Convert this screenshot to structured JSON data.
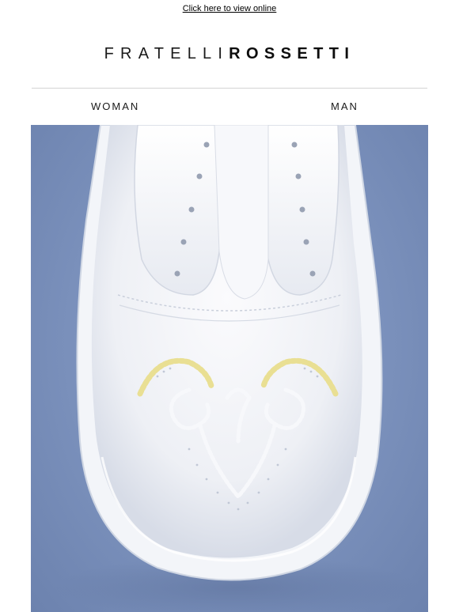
{
  "preheader": {
    "view_online_label": "Click here to view online"
  },
  "brand": {
    "name_light": "FRATELLI",
    "name_bold": "ROSSETTI"
  },
  "nav": {
    "items": [
      {
        "label": "WOMAN"
      },
      {
        "label": "MAN"
      }
    ]
  },
  "hero": {
    "subject": "white leather slip-on sneaker with heart stitching",
    "colors": {
      "background": "#7e94bf",
      "shoe": "#f4f5f8",
      "stitch_yellow": "#e9df93",
      "stitch_white": "#f7f8fb"
    }
  }
}
